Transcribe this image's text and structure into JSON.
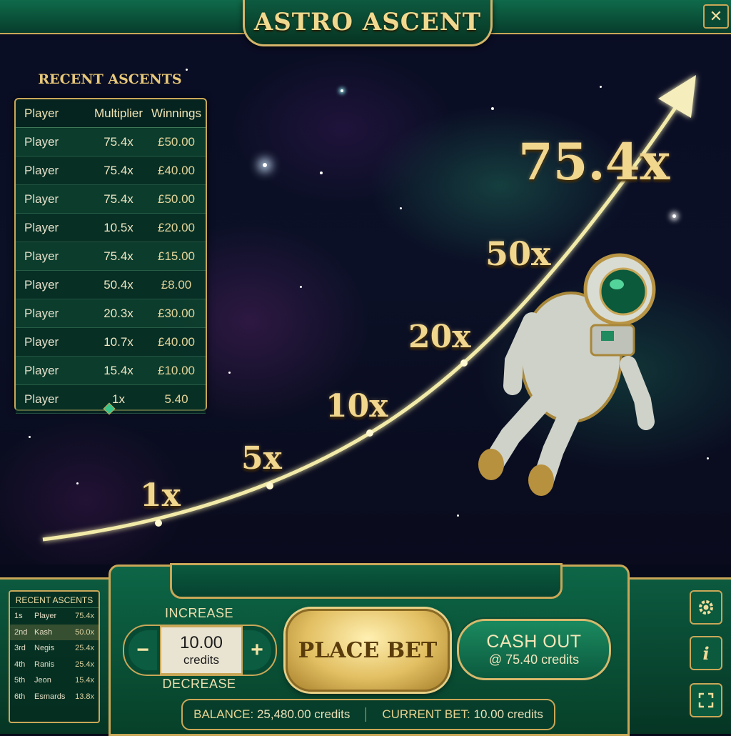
{
  "header": {
    "title": "ASTRO ASCENT",
    "close_label": "✕"
  },
  "recent_ascents": {
    "title": "RECENT ASCENTS",
    "columns": [
      "Player",
      "Multiplier",
      "Winnings"
    ],
    "rows": [
      {
        "player": "Player",
        "multiplier": "75.4x",
        "winnings": "£50.00"
      },
      {
        "player": "Player",
        "multiplier": "75.4x",
        "winnings": "£40.00"
      },
      {
        "player": "Player",
        "multiplier": "75.4x",
        "winnings": "£50.00"
      },
      {
        "player": "Player",
        "multiplier": "10.5x",
        "winnings": "£20.00"
      },
      {
        "player": "Player",
        "multiplier": "75.4x",
        "winnings": "£15.00"
      },
      {
        "player": "Player",
        "multiplier": "50.4x",
        "winnings": "£8.00"
      },
      {
        "player": "Player",
        "multiplier": "20.3x",
        "winnings": "£30.00"
      },
      {
        "player": "Player",
        "multiplier": "10.7x",
        "winnings": "£40.00"
      },
      {
        "player": "Player",
        "multiplier": "15.4x",
        "winnings": "£10.00"
      },
      {
        "player": "Player",
        "multiplier": "1x",
        "winnings": "5.40"
      }
    ]
  },
  "curve": {
    "markers": [
      "1x",
      "5x",
      "10x",
      "20x",
      "50x"
    ],
    "current_multiplier": "75.4x"
  },
  "mini_leaderboard": {
    "title": "RECENT ASCENTS",
    "rows": [
      {
        "rank": "1s",
        "name": "Player",
        "mult": "75.4x"
      },
      {
        "rank": "2nd",
        "name": "Kash",
        "mult": "50.0x"
      },
      {
        "rank": "3rd",
        "name": "Negis",
        "mult": "25.4x"
      },
      {
        "rank": "4th",
        "name": "Ranis",
        "mult": "25.4x"
      },
      {
        "rank": "5th",
        "name": "Jeon",
        "mult": "15.4x"
      },
      {
        "rank": "6th",
        "name": "Esmards",
        "mult": "13.8x"
      }
    ]
  },
  "controls": {
    "increase_label": "INCREASE",
    "decrease_label": "DECREASE",
    "minus_label": "−",
    "plus_label": "+",
    "bet_amount": "10.00",
    "bet_unit": "credits",
    "place_bet_label": "PLACE BET",
    "cash_out_label": "CASH OUT",
    "cash_out_value": "@ 75.40 credits"
  },
  "status": {
    "balance_key": "BALANCE:",
    "balance_value": "25,480.00 credits",
    "current_bet_key": "CURRENT BET:",
    "current_bet_value": "10.00 credits"
  },
  "side_buttons": {
    "settings_icon": "gear-icon",
    "info_icon": "info-icon",
    "fullscreen_icon": "fullscreen-icon",
    "info_label": "i"
  },
  "colors": {
    "accent_gold": "#c9a758",
    "panel_green": "#0c5a3f",
    "curve": "#f2eaa8"
  }
}
